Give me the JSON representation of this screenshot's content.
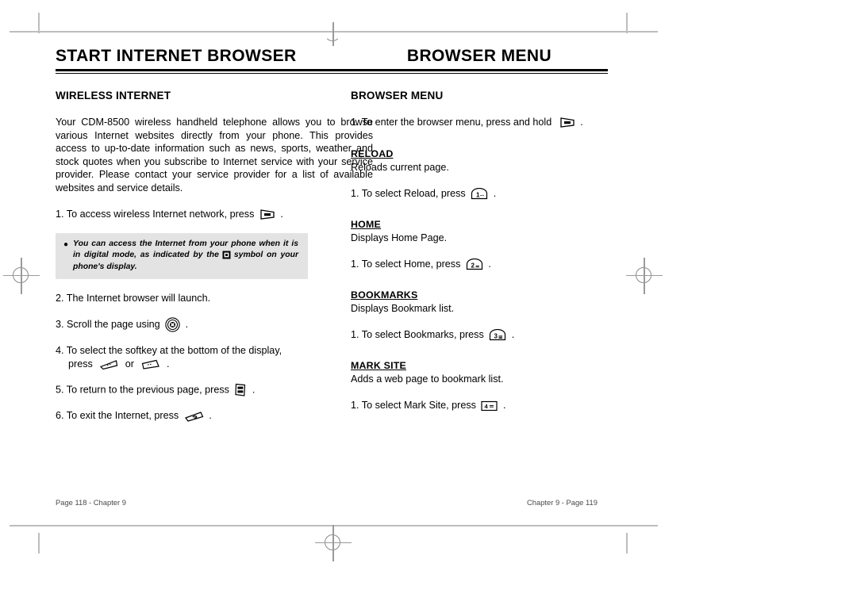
{
  "document": {
    "type": "phone-user-manual-spread"
  },
  "left_page": {
    "chapter_title": "START INTERNET BROWSER",
    "section_heading": "WIRELESS INTERNET",
    "intro_paragraph": "Your CDM-8500 wireless handheld telephone allows you to browse various Internet websites directly from your phone. This provides access to up-to-date information such as news, sports, weather and stock quotes when you subscribe to Internet service with your service provider. Please contact your service provider for a list of available websites and service details.",
    "steps": [
      {
        "number": "1.",
        "text_before": "To access wireless Internet network, press",
        "key": "www-key",
        "text_after": "."
      },
      {
        "number": "2.",
        "text_before": "The Internet browser will launch.",
        "key": "",
        "text_after": ""
      },
      {
        "number": "3.",
        "text_before": "Scroll the page using",
        "key": "navigation-key",
        "text_after": "."
      },
      {
        "number": "4.",
        "text_before": "To select the softkey at the bottom of the display,",
        "text_indent_before": "press",
        "key": "left-softkey",
        "text_middle": "or",
        "key2": "right-softkey",
        "text_after": "."
      },
      {
        "number": "5.",
        "text_before": "To return to the previous page, press",
        "key": "clear-key",
        "text_after": "."
      },
      {
        "number": "6.",
        "text_before": "To exit the Internet, press",
        "key": "end-key",
        "text_after": "."
      }
    ],
    "note": {
      "bullet": "●",
      "text_part1": "You can access the Internet from your phone when it is in digital mode, as indicated by the",
      "icon": "digital-mode-icon",
      "text_part2": "symbol on your phone's display."
    },
    "footer": "Page 118 - Chapter 9"
  },
  "right_page": {
    "chapter_title": "BROWSER MENU",
    "section_heading": "BROWSER MENU",
    "intro_step": {
      "number": "1.",
      "text_before": "To enter the browser menu, press and hold",
      "key": "www-key",
      "text_after": "."
    },
    "menu_items": [
      {
        "title": "RELOAD",
        "description": "Reloads current page.",
        "step_number": "1.",
        "step_text": "To select Reload, press",
        "key": "number-1-key",
        "key_label": "1",
        "step_after": "."
      },
      {
        "title": "HOME",
        "description": "Displays Home Page.",
        "step_number": "1.",
        "step_text": "To select Home, press",
        "key": "number-2-key",
        "key_label": "2",
        "step_after": "."
      },
      {
        "title": "BOOKMARKS",
        "description": "Displays Bookmark list.",
        "step_number": "1.",
        "step_text": "To select Bookmarks, press",
        "key": "number-3-key",
        "key_label": "3",
        "step_after": "."
      },
      {
        "title": "MARK SITE",
        "description": "Adds a web page to bookmark list.",
        "step_number": "1.",
        "step_text": "To select Mark Site, press",
        "key": "number-4-key",
        "key_label": "4",
        "step_after": "."
      }
    ],
    "footer": "Chapter 9 - Page 119"
  },
  "colors": {
    "text": "#000000",
    "note_background": "#e3e3e3",
    "footer_text": "#4a4a4a",
    "crop_mark": "#bdbdbd"
  }
}
